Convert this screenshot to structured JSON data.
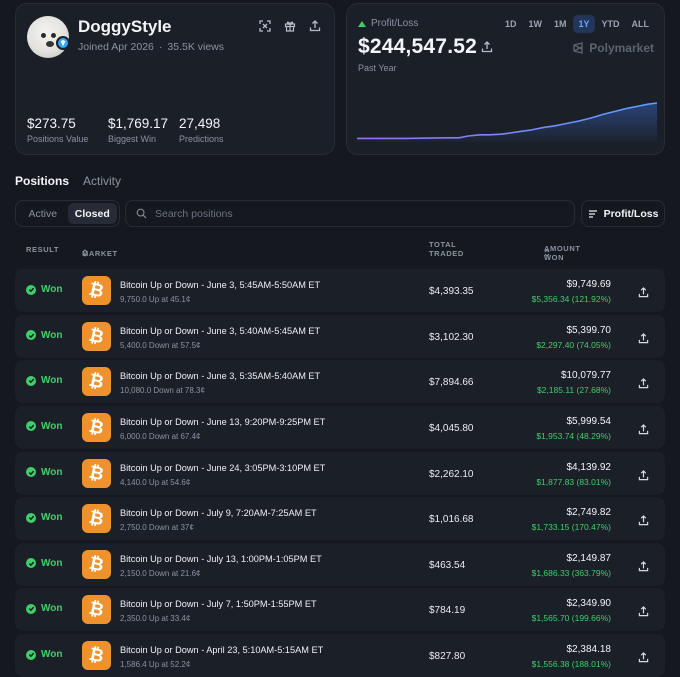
{
  "profile": {
    "username": "DoggyStyle",
    "joined": "Joined Apr 2026",
    "views": "35.5K views",
    "stats": [
      {
        "value": "$273.75",
        "label": "Positions Value"
      },
      {
        "value": "$1,769.17",
        "label": "Biggest Win"
      },
      {
        "value": "27,498",
        "label": "Predictions"
      }
    ],
    "icons": [
      "scan-icon",
      "gift-icon",
      "share-icon"
    ]
  },
  "pnl": {
    "label": "Profit/Loss",
    "value": "$244,547.52",
    "period": "Past Year",
    "ranges": [
      "1D",
      "1W",
      "1M",
      "1Y",
      "YTD",
      "ALL"
    ],
    "active_range": "1Y",
    "brand": "Polymarket",
    "colors": {
      "up": "#3ecf6b",
      "line_start": "#9b6cf5",
      "line_end": "#5aa0ff"
    },
    "chart_data": {
      "type": "area",
      "x_range": [
        0,
        100
      ],
      "y_range": [
        0,
        100
      ],
      "points": [
        [
          0,
          6
        ],
        [
          16,
          6
        ],
        [
          30,
          7
        ],
        [
          34,
          7
        ],
        [
          37,
          10
        ],
        [
          41,
          12
        ],
        [
          44,
          12
        ],
        [
          48,
          13
        ],
        [
          51,
          15
        ],
        [
          55,
          18
        ],
        [
          58,
          20
        ],
        [
          62,
          24
        ],
        [
          66,
          27
        ],
        [
          70,
          31
        ],
        [
          74,
          35
        ],
        [
          78,
          40
        ],
        [
          82,
          46
        ],
        [
          86,
          51
        ],
        [
          90,
          56
        ],
        [
          94,
          60
        ],
        [
          97,
          63
        ],
        [
          100,
          65
        ]
      ]
    }
  },
  "tabs": [
    {
      "label": "Positions",
      "active": true
    },
    {
      "label": "Activity",
      "active": false
    }
  ],
  "filter": {
    "segments": [
      {
        "label": "Active",
        "active": false
      },
      {
        "label": "Closed",
        "active": true
      }
    ],
    "search_placeholder": "Search positions",
    "sort_label": "Profit/Loss"
  },
  "table": {
    "headers": {
      "result": "RESULT",
      "market": "MARKET",
      "traded": "TOTAL TRADED",
      "won": "AMOUNT WON"
    },
    "rows": [
      {
        "result": "Won",
        "title": "Bitcoin Up or Down - June 3, 5:45AM-5:50AM ET",
        "sub": "9,750.0 Up at 45.1¢",
        "traded": "$4,393.35",
        "amount": "$9,749.69",
        "gain": "$5,356.34 (121.92%)"
      },
      {
        "result": "Won",
        "title": "Bitcoin Up or Down - June 3, 5:40AM-5:45AM ET",
        "sub": "5,400.0 Down at 57.5¢",
        "traded": "$3,102.30",
        "amount": "$5,399.70",
        "gain": "$2,297.40 (74.05%)"
      },
      {
        "result": "Won",
        "title": "Bitcoin Up or Down - June 3, 5:35AM-5:40AM ET",
        "sub": "10,080.0 Down at 78.3¢",
        "traded": "$7,894.66",
        "amount": "$10,079.77",
        "gain": "$2,185.11 (27.68%)"
      },
      {
        "result": "Won",
        "title": "Bitcoin Up or Down - June 13, 9:20PM-9:25PM ET",
        "sub": "6,000.0 Down at 67.4¢",
        "traded": "$4,045.80",
        "amount": "$5,999.54",
        "gain": "$1,953.74 (48.29%)"
      },
      {
        "result": "Won",
        "title": "Bitcoin Up or Down - June 24, 3:05PM-3:10PM ET",
        "sub": "4,140.0 Up at 54.6¢",
        "traded": "$2,262.10",
        "amount": "$4,139.92",
        "gain": "$1,877.83 (83.01%)"
      },
      {
        "result": "Won",
        "title": "Bitcoin Up or Down - July 9, 7:20AM-7:25AM ET",
        "sub": "2,750.0 Down at 37¢",
        "traded": "$1,016.68",
        "amount": "$2,749.82",
        "gain": "$1,733.15 (170.47%)"
      },
      {
        "result": "Won",
        "title": "Bitcoin Up or Down - July 13, 1:00PM-1:05PM ET",
        "sub": "2,150.0 Down at 21.6¢",
        "traded": "$463.54",
        "amount": "$2,149.87",
        "gain": "$1,686.33 (363.79%)"
      },
      {
        "result": "Won",
        "title": "Bitcoin Up or Down - July 7, 1:50PM-1:55PM ET",
        "sub": "2,350.0 Up at 33.4¢",
        "traded": "$784.19",
        "amount": "$2,349.90",
        "gain": "$1,565.70 (199.66%)"
      },
      {
        "result": "Won",
        "title": "Bitcoin Up or Down - April 23, 5:10AM-5:15AM ET",
        "sub": "1,586.4 Up at 52.2¢",
        "traded": "$827.80",
        "amount": "$2,384.18",
        "gain": "$1,556.38 (188.01%)"
      }
    ]
  }
}
